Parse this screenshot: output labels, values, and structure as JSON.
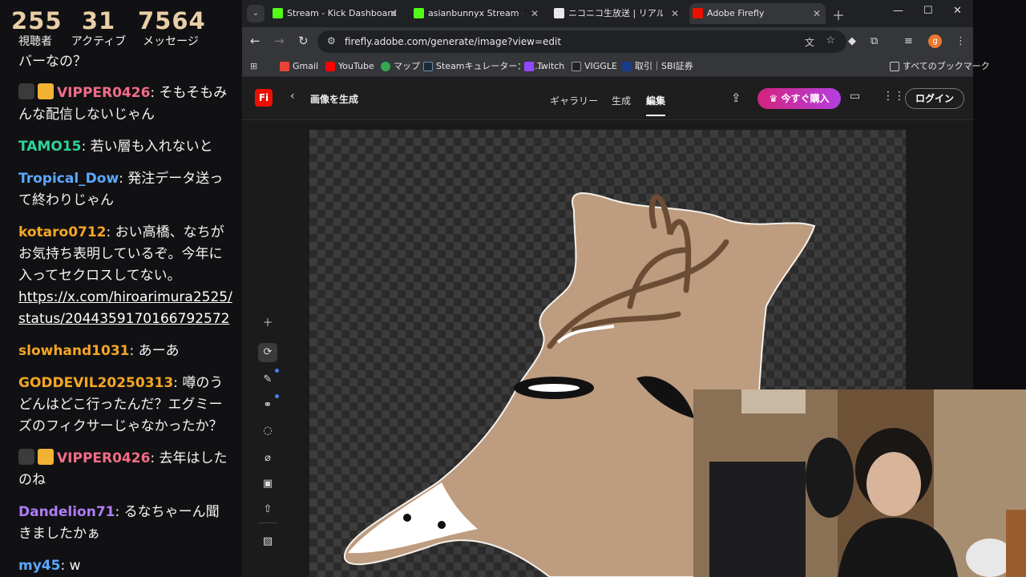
{
  "chat_stats": {
    "viewers": "255",
    "viewers_label": "視聴者",
    "active": "31",
    "active_label": "アクティブ",
    "messages": "7564",
    "messages_label": "メッセージ"
  },
  "chat": {
    "partial_top": "バーなの？",
    "messages": [
      {
        "user": "VIPPER0426",
        "color": "#f36c86",
        "text": ": そもそもみんな配信しないじゃん"
      },
      {
        "user": "TAMO15",
        "color": "#2fd39a",
        "text": ": 若い層も入れないと"
      },
      {
        "user": "Tropical_Dow",
        "color": "#5ba8ff",
        "text": ": 発注データ送って終わりじゃん"
      },
      {
        "user": "kotaro0712",
        "color": "#f5a623",
        "text": ": おい高橋、なちがお気持ち表明しているぞ。今年に入ってセクロスしてない。",
        "link": "https://x.com/hiroarimura2525/status/2044359170166792572"
      },
      {
        "user": "slowhand1031",
        "color": "#f5a623",
        "text": ": あーあ"
      },
      {
        "user": "GODDEVIL20250313",
        "color": "#f5a623",
        "text": ": 噂のうどんはどこ行ったんだ？エグミーズのフィクサーじゃなかったか？"
      },
      {
        "user": "VIPPER0426",
        "color": "#f36c86",
        "text": ": 去年はしたのね"
      },
      {
        "user": "Dandelion71",
        "color": "#b07cf6",
        "text": ": るなちゃーん聞きましたかぁ"
      },
      {
        "user": "my45",
        "color": "#5ba8ff",
        "text": ": w"
      }
    ]
  },
  "browser": {
    "tabs": [
      {
        "title": "Stream - Kick Dashboard",
        "fav_color": "#53fc18"
      },
      {
        "title": "asianbunnyx Stream - Wat",
        "fav_color": "#53fc18"
      },
      {
        "title": "ニコニコ生放送 | リアルタイム",
        "fav_color": "#e8e8e8"
      },
      {
        "title": "Adobe Firefly",
        "fav_color": "#eb1000"
      }
    ],
    "url": "firefly.adobe.com/generate/image?view=edit",
    "profile_initial": "g",
    "bookmarks": [
      {
        "label": "Gmail",
        "color": "#ea4335"
      },
      {
        "label": "YouTube",
        "color": "#ff0000"
      },
      {
        "label": "マップ",
        "color": "#34a853"
      },
      {
        "label": "Steamキュレーター：収...",
        "color": "#1b2838"
      },
      {
        "label": "Twitch",
        "color": "#9146ff"
      },
      {
        "label": "VIGGLE",
        "color": "#222222"
      },
      {
        "label": "取引｜SBI証券",
        "color": "#1a3c8c"
      }
    ],
    "all_bookmarks": "すべてのブックマーク"
  },
  "firefly": {
    "logo": "Fi",
    "title": "画像を生成",
    "nav": [
      "ギャラリー",
      "生成",
      "編集"
    ],
    "buy_label": "今すぐ購入",
    "login_label": "ログイン"
  }
}
